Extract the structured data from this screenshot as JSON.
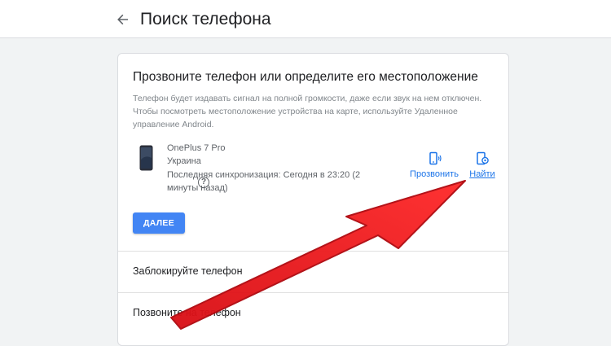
{
  "header": {
    "title": "Поиск телефона",
    "back_icon": "arrow-back-icon"
  },
  "card": {
    "title": "Прозвоните телефон или определите его местоположение",
    "description": "Телефон будет издавать сигнал на полной громкости, даже если звук на нем отключен. Чтобы посмотреть местоположение устройства на карте, используйте Удаленное управление Android.",
    "device": {
      "name": "OnePlus 7 Pro",
      "country": "Украина",
      "sync": "Последняя синхронизация: Сегодня в 23:20 (2 минуты назад)"
    },
    "actions": {
      "ring_label": "Прозвонить",
      "find_label": "Найти"
    },
    "next_button": "ДАЛЕЕ"
  },
  "rows": {
    "lock": "Заблокируйте телефон",
    "call": "Позвоните на телефон"
  },
  "colors": {
    "accent": "#1a73e8",
    "button": "#4285f4",
    "annotation_arrow": "#e8141c"
  }
}
